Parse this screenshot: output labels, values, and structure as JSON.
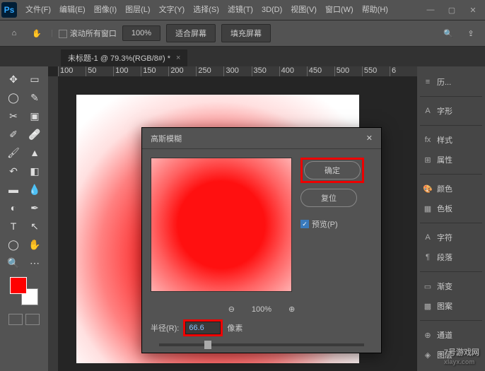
{
  "menubar": {
    "items": [
      "文件(F)",
      "编辑(E)",
      "图像(I)",
      "图层(L)",
      "文字(Y)",
      "选择(S)",
      "滤镜(T)",
      "3D(D)",
      "视图(V)",
      "窗口(W)",
      "帮助(H)"
    ]
  },
  "optbar": {
    "scroll_all": "滚动所有窗口",
    "zoom": "100%",
    "fit": "适合屏幕",
    "fill": "填充屏幕"
  },
  "tab": {
    "title": "未标题-1 @ 79.3%(RGB/8#) *"
  },
  "ruler": [
    "100",
    "50",
    "100",
    "150",
    "200",
    "250",
    "300",
    "350",
    "400",
    "450",
    "500",
    "550",
    "6"
  ],
  "panels": [
    {
      "icon": "≡",
      "label": "历..."
    },
    {
      "icon": "A",
      "label": "字形"
    },
    {
      "icon": "fx",
      "label": "样式"
    },
    {
      "icon": "⊞",
      "label": "属性"
    },
    {
      "icon": "🎨",
      "label": "颜色"
    },
    {
      "icon": "▦",
      "label": "色板"
    },
    {
      "icon": "A",
      "label": "字符"
    },
    {
      "icon": "¶",
      "label": "段落"
    },
    {
      "icon": "▭",
      "label": "渐变"
    },
    {
      "icon": "▩",
      "label": "图案"
    },
    {
      "icon": "⊕",
      "label": "通道"
    },
    {
      "icon": "◈",
      "label": "图层"
    }
  ],
  "dialog": {
    "title": "高斯模糊",
    "ok": "确定",
    "reset": "复位",
    "preview": "预览(P)",
    "zoom": "100%",
    "radius_label": "半径(R):",
    "radius_value": "66.6",
    "radius_unit": "像素"
  },
  "watermark": {
    "main": "7号游戏网",
    "sub": "xlayx.com"
  }
}
